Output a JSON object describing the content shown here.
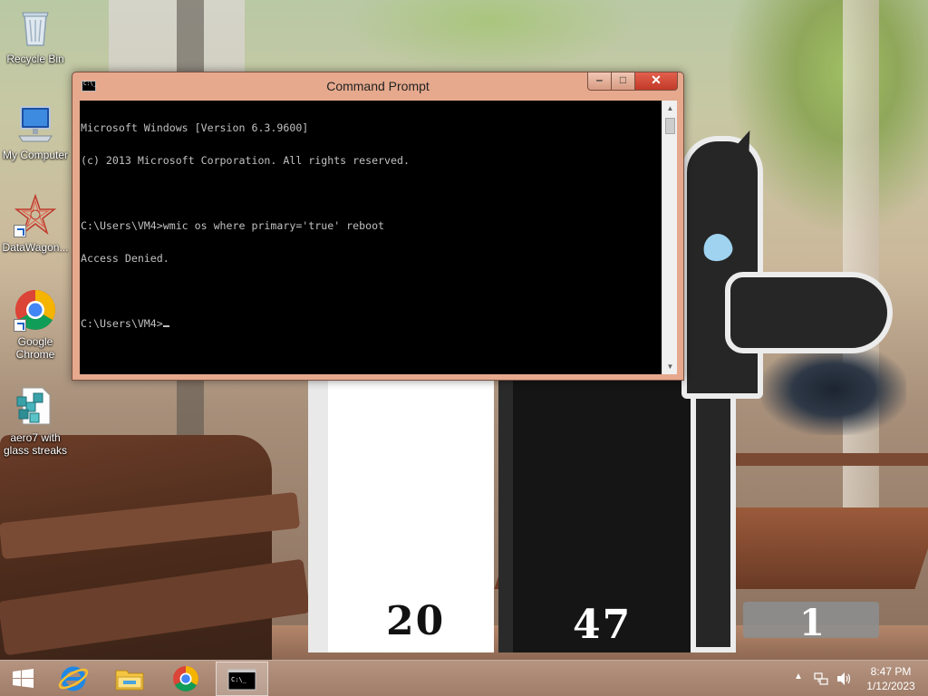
{
  "desktop": {
    "icons": [
      {
        "label": "Recycle Bin",
        "icon": "recycle-bin-icon"
      },
      {
        "label": "My Computer",
        "icon": "computer-icon"
      },
      {
        "label": "DataWagon...",
        "icon": "datawagon-icon"
      },
      {
        "label": "Google Chrome",
        "icon": "chrome-icon"
      },
      {
        "label": "aero7 with glass streaks",
        "icon": "registry-file-icon"
      }
    ]
  },
  "wallpaper": {
    "calendar": {
      "day": "20",
      "hour": "47",
      "month": "1"
    }
  },
  "cmd": {
    "title": "Command Prompt",
    "lines": [
      "Microsoft Windows [Version 6.3.9600]",
      "(c) 2013 Microsoft Corporation. All rights reserved.",
      "",
      "C:\\Users\\VM4>wmic os where primary='true' reboot",
      "Access Denied.",
      "",
      "C:\\Users\\VM4>"
    ],
    "minimize_glyph": "‒",
    "maximize_glyph": "□",
    "close_glyph": "✕",
    "colors": {
      "frame": "#e6a98d",
      "console_bg": "#000000",
      "console_fg": "#c0c0c0"
    }
  },
  "taskbar": {
    "start_icon": "windows-logo-icon",
    "pinned": [
      {
        "name": "internet-explorer",
        "icon": "ie-icon"
      },
      {
        "name": "file-explorer",
        "icon": "folder-icon"
      },
      {
        "name": "chrome",
        "icon": "chrome-icon"
      },
      {
        "name": "command-prompt",
        "icon": "cmd-icon",
        "active": true
      }
    ],
    "tray": {
      "chevron": "▲",
      "time": "8:47 PM",
      "date": "1/12/2023"
    }
  }
}
